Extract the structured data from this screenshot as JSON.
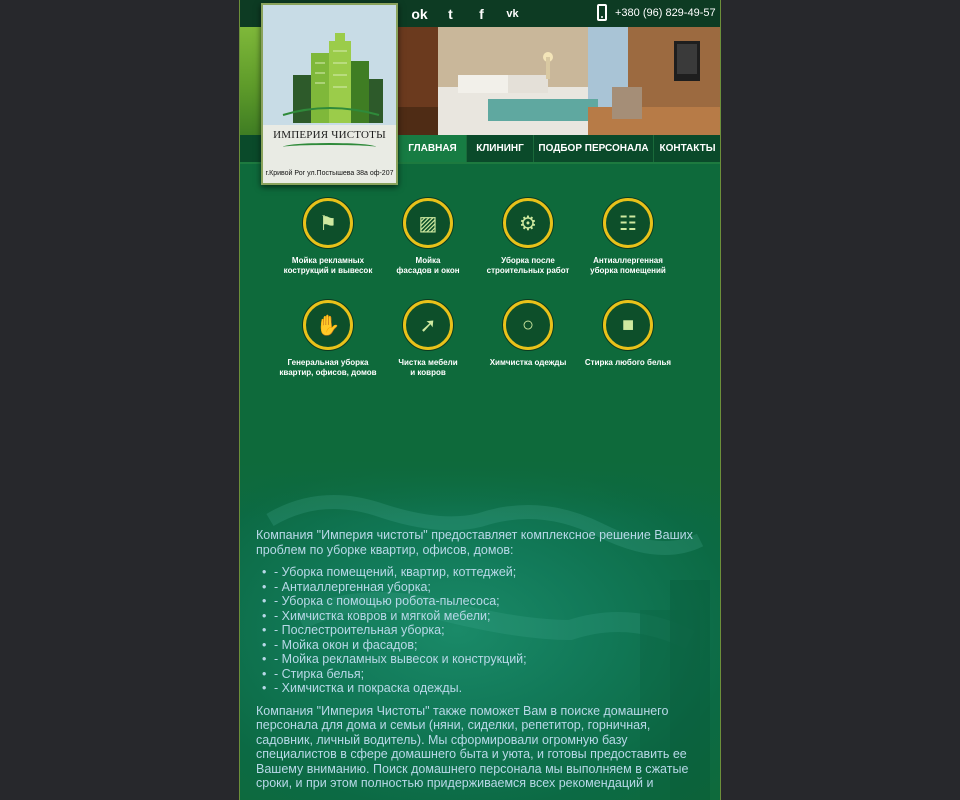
{
  "header": {
    "phone": "+380 (96) 829-49-57",
    "socials": [
      {
        "icon": "odnoklassniki-icon",
        "glyph": "ok"
      },
      {
        "icon": "twitter-icon",
        "glyph": "t"
      },
      {
        "icon": "facebook-icon",
        "glyph": "f"
      },
      {
        "icon": "vk-icon",
        "glyph": "vk"
      }
    ]
  },
  "logo": {
    "name": "ИМПЕРИЯ ЧИСТОТЫ",
    "address": "г.Кривой Рог ул.Постышева 38а оф-207"
  },
  "nav": {
    "items": [
      {
        "label": "ГЛАВНАЯ",
        "active": true
      },
      {
        "label": "КЛИНИНГ",
        "active": false
      },
      {
        "label": "ПОДБОР ПЕРСОНАЛА",
        "active": false
      },
      {
        "label": "КОНТАКТЫ",
        "active": false
      }
    ]
  },
  "services": [
    {
      "label": "Мойка рекламных\nкострукций и вывесок",
      "icon": "worker-icon"
    },
    {
      "label": "Мойка\nфасадов и окон",
      "icon": "bucket-icon"
    },
    {
      "label": "Уборка после\nстроительных работ",
      "icon": "broom-icon"
    },
    {
      "label": "Антиаллергенная\nуборка помещений",
      "icon": "detergent-icon"
    },
    {
      "label": "Генеральная уборка\nквартир, офисов, домов",
      "icon": "glove-sponge-icon"
    },
    {
      "label": "Чистка мебели\nи ковров",
      "icon": "vacuum-icon"
    },
    {
      "label": "Химчистка одежды",
      "icon": "bubbles-icon"
    },
    {
      "label": "Стирка любого белья",
      "icon": "laundry-icon"
    }
  ],
  "content": {
    "intro": "Компания \"Империя чистоты\" предоставляет комплексное решение Ваших проблем по уборке квартир, офисов, домов:",
    "list": [
      "- Уборка помещений, квартир, коттеджей;",
      "- Антиаллергенная уборка;",
      "- Уборка с помощью робота-пылесоса;",
      "- Химчистка ковров и мягкой мебели;",
      "- Послестроительная уборка;",
      "- Мойка окон и фасадов;",
      "- Мойка рекламных вывесок и конструкций;",
      "- Стирка белья;",
      "- Химчистка и покраска одежды."
    ],
    "para2": "Компания \"Империя Чистоты\" также поможет Вам в поиске домашнего персонала для дома и семьи (няни, сиделки, репетитор, горничная, садовник, личный водитель). Мы сформировали огромную базу специалистов в сфере домашнего быта и уюта, и готовы предоставить ее Вашему вниманию. Поиск домашнего персонала мы выполняем в сжатые сроки, и при этом полностью придерживаемся всех рекомендаций и"
  },
  "colors": {
    "page_bg": "#27282c",
    "content_bg": "#0e6a3b",
    "accent_ring": "#e8c21a",
    "text": "#b8d8e8"
  }
}
